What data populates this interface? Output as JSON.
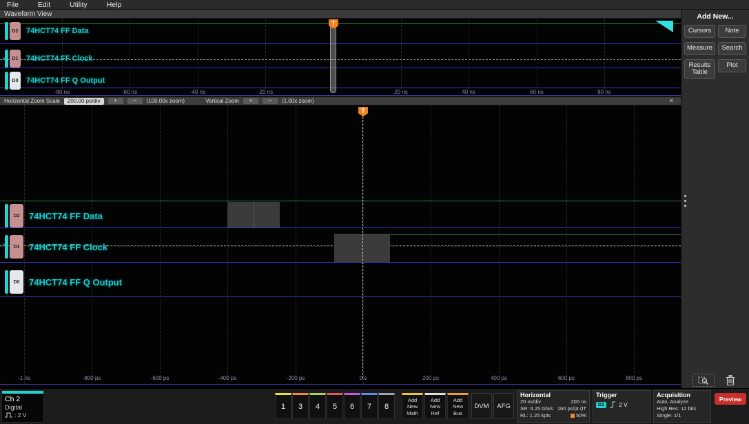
{
  "colors": {
    "accent_cyan": "#22d3d3",
    "trace_green": "#2e7d32",
    "trace_blue": "#3636c8",
    "trigger_orange": "#f08021",
    "preview_red": "#c9302c"
  },
  "menu": {
    "items": [
      {
        "label": "File"
      },
      {
        "label": "Edit"
      },
      {
        "label": "Utility"
      },
      {
        "label": "Help"
      }
    ]
  },
  "view_tab": {
    "label": "Waveform View"
  },
  "channels": [
    {
      "badge": "D2",
      "label": "74HCT74 FF Data"
    },
    {
      "badge": "D1",
      "label": "74HCT74 FF Clock"
    },
    {
      "badge": "D0",
      "label": "74HCT74 FF Q Output"
    }
  ],
  "overview": {
    "axis_ticks": [
      "-80 ns",
      "-60 ns",
      "-40 ns",
      "-20 ns",
      "20 ns",
      "40 ns",
      "60 ns",
      "80 ns"
    ],
    "trigger_flag": "T",
    "trigger_source_marker": "->"
  },
  "zoom_toolbar": {
    "h_label": "Horizontal Zoom Scale",
    "h_scale": "200.00 ps/div",
    "plus": "+",
    "minus": "−",
    "h_zoom": "(100.00x zoom)",
    "v_label": "Vertical Zoom",
    "v_zoom": "(1.00x zoom)",
    "close": "✕"
  },
  "main": {
    "axis_ticks": [
      "-1 ns",
      "-800 ps",
      "-600 ps",
      "-400 ps",
      "-200 ps",
      "0 s",
      "200 ps",
      "400 ps",
      "600 ps",
      "800 ps"
    ],
    "trigger_flag": "T",
    "trigger_source_marker": "->"
  },
  "right_panel": {
    "title": "Add New...",
    "buttons": [
      {
        "label": "Cursors"
      },
      {
        "label": "Note"
      },
      {
        "label": "Measure"
      },
      {
        "label": "Search"
      },
      {
        "label": "Results Table"
      },
      {
        "label": "Plot"
      }
    ]
  },
  "bottom_bar": {
    "channel_badge": {
      "name": "Ch 2",
      "kind": "Digital",
      "threshold": ": 2 V"
    },
    "channel_buttons": [
      {
        "label": "1",
        "color": "#e6df3a"
      },
      {
        "label": "3",
        "color": "#f08a3c"
      },
      {
        "label": "4",
        "color": "#a9cf54"
      },
      {
        "label": "5",
        "color": "#e05a5a"
      },
      {
        "label": "6",
        "color": "#c45ad9"
      },
      {
        "label": "7",
        "color": "#5a8de0"
      },
      {
        "label": "8",
        "color": "#97a4b5"
      }
    ],
    "add_buttons": [
      {
        "label": "Add New Math",
        "color": "#f0c23c"
      },
      {
        "label": "Add New Ref",
        "color": "#e0e0e0"
      },
      {
        "label": "Add New Bus",
        "color": "#f0983c"
      }
    ],
    "dvm": "DVM",
    "afg": "AFG",
    "horizontal": {
      "title": "Horizontal",
      "rows": [
        [
          "20 ns/div",
          "200 ns"
        ],
        [
          "SR: 6.25 GS/s",
          "160 ps/pt (IT"
        ],
        [
          "RL: 1.25 kpts",
          "50%"
        ]
      ]
    },
    "trigger": {
      "title": "Trigger",
      "source": "D1",
      "level": "2 V"
    },
    "acquisition": {
      "title": "Acquisition",
      "lines": [
        "Auto,  Analyze",
        "High Res: 12 bits",
        "Single: 1/1"
      ]
    },
    "preview": "Preview"
  }
}
